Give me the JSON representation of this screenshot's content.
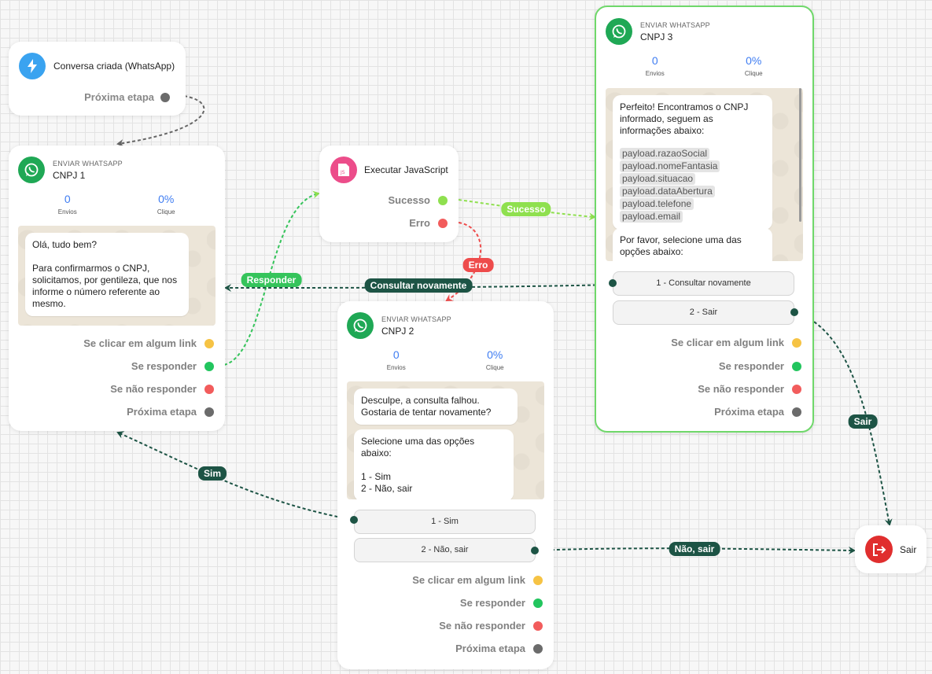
{
  "colors": {
    "accent": "#3f7df2",
    "whatsapp": "#1fa855",
    "yellow": "#f6c344",
    "green": "#22c55e",
    "red": "#f25c5c",
    "gray": "#6b6b6b",
    "edge_dark": "#1d5445",
    "edge_green": "#8fe04f",
    "edge_red": "#ee4c4c",
    "selected": "#6fd86a"
  },
  "trigger": {
    "title": "Conversa criada (WhatsApp)",
    "icon": "bolt-icon",
    "next_label": "Próxima etapa"
  },
  "cnpj1": {
    "type": "ENVIAR WHATSAPP",
    "title": "CNPJ 1",
    "sends": "0",
    "sends_label": "Envios",
    "clicks": "0%",
    "clicks_label": "Clique",
    "message": "Olá, tudo bem?\n\nPara confirmarmos o CNPJ, solicitamos, por gentileza, que nos informe o número referente ao mesmo.",
    "outputs": [
      "Se clicar em algum link",
      "Se responder",
      "Se não responder",
      "Próxima etapa"
    ]
  },
  "js": {
    "title": "Executar JavaScript",
    "icon": "javascript-icon",
    "success": "Sucesso",
    "error": "Erro"
  },
  "cnpj2": {
    "type": "ENVIAR WHATSAPP",
    "title": "CNPJ 2",
    "sends": "0",
    "sends_label": "Envios",
    "clicks": "0%",
    "clicks_label": "Clique",
    "message1": "Desculpe, a consulta falhou.\nGostaria de tentar novamente?",
    "message2": "Selecione uma das opções abaixo:\n\n1 - Sim\n2 - Não, sair",
    "options": [
      "1 - Sim",
      "2 - Não, sair"
    ],
    "outputs": [
      "Se clicar em algum link",
      "Se responder",
      "Se não responder",
      "Próxima etapa"
    ]
  },
  "cnpj3": {
    "type": "ENVIAR WHATSAPP",
    "title": "CNPJ 3",
    "sends": "0",
    "sends_label": "Envios",
    "clicks": "0%",
    "clicks_label": "Clique",
    "message1_intro": "Perfeito! Encontramos o CNPJ informado, seguem as informações abaixo:",
    "payload_fields": [
      "payload.razaoSocial",
      "payload.nomeFantasia",
      "payload.situacao",
      "payload.dataAbertura",
      "payload.telefone",
      "payload.email"
    ],
    "message2": "Por favor, selecione uma das opções abaixo:",
    "options": [
      "1 - Consultar novamente",
      "2 - Sair"
    ],
    "outputs": [
      "Se clicar em algum link",
      "Se responder",
      "Se não responder",
      "Próxima etapa"
    ]
  },
  "exit": {
    "title": "Sair",
    "icon": "exit-icon"
  },
  "edge_labels": {
    "responder": "Responder",
    "sucesso": "Sucesso",
    "erro": "Erro",
    "consultar": "Consultar novamente",
    "sim": "Sim",
    "sair": "Sair",
    "nao_sair": "Não, sair"
  }
}
